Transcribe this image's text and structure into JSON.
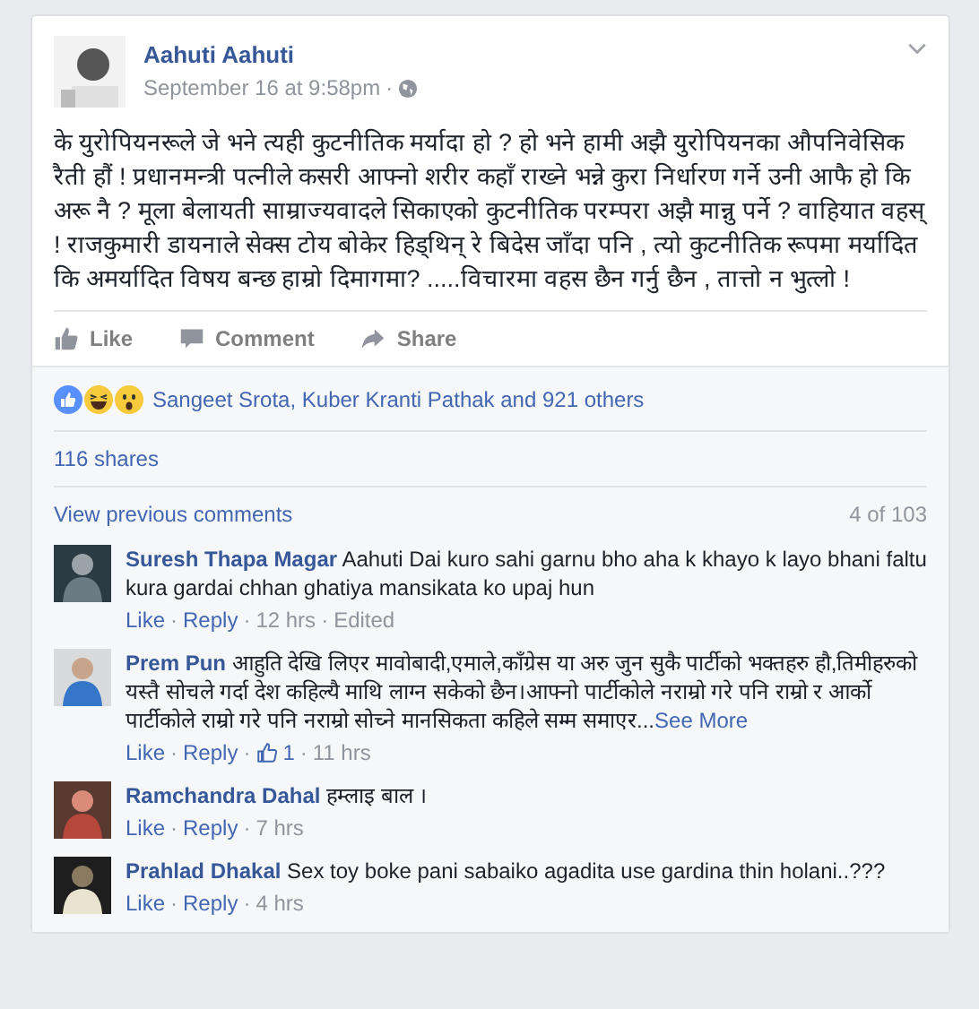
{
  "post": {
    "author": "Aahuti Aahuti",
    "timestamp": "September 16 at 9:58pm",
    "separator": "·",
    "text": "के युरोपियनरूले जे भने त्यही कुटनीतिक मर्यादा हो ? हो भने हामी अझै युरोपियनका औपनिवेसिक रैती हौं ! प्रधानमन्त्री पत्नीले कसरी आफ्नो शरीर कहाँ राख्ने भन्ने कुरा निर्धारण गर्ने उनी आफै हो कि अरू नै ? मूला बेलायती साम्राज्यवादले सिकाएको कुटनीतिक परम्परा अझै मान्नु पर्ने ? वाहियात वहस् ! राजकुमारी डायनाले सेक्स टोय बोकेर हिड्थिन् रे बिदेस जाँदा पनि , त्यो कुटनीतिक रूपमा मर्यादित कि अमर्यादित विषय बन्छ हाम्रो दिमागमा? .....विचारमा वहस छैन गर्नु छैन , तात्तो न भुत्लो !"
  },
  "actions": [
    "Like",
    "Comment",
    "Share"
  ],
  "reactions": {
    "summary": "Sangeet Srota, Kuber Kranti Pathak and 921 others"
  },
  "shares": "116 shares",
  "comments_header": {
    "link": "View previous comments",
    "count": "4 of 103"
  },
  "comments": [
    {
      "author": "Suresh Thapa Magar",
      "text": "Aahuti Dai kuro sahi garnu bho aha k khayo k layo bhani faltu kura gardai chhan ghatiya mansikata ko upaj hun",
      "meta": [
        {
          "kind": "like",
          "text": "Like"
        },
        {
          "kind": "sep",
          "text": "·"
        },
        {
          "kind": "reply",
          "text": "Reply"
        },
        {
          "kind": "sep",
          "text": "·"
        },
        {
          "kind": "time",
          "text": "12 hrs"
        },
        {
          "kind": "sep",
          "text": "·"
        },
        {
          "kind": "edited",
          "text": "Edited"
        }
      ]
    },
    {
      "author": "Prem Pun",
      "text": "आहुति देखि लिएर मावोबादी,एमाले,काँग्रेस या अरु जुन सुकै पार्टीको भक्तहरु हौ,तिमीहरुको यस्तै सोचले गर्दा देश कहिल्यै माथि लाग्न सकेको छैन।आफ्नो पार्टीकोले नराम्रो गरे पनि राम्रो र आर्को पार्टीकोले राम्रो गरे पनि नराम्रो सोच्ने मानसिकता कहिले सम्म समाएर...",
      "see_more": "See More",
      "meta": [
        {
          "kind": "like",
          "text": "Like"
        },
        {
          "kind": "sep",
          "text": "·"
        },
        {
          "kind": "reply",
          "text": "Reply"
        },
        {
          "kind": "sep",
          "text": "·"
        },
        {
          "kind": "likes",
          "text": "1"
        },
        {
          "kind": "sep",
          "text": "·"
        },
        {
          "kind": "time",
          "text": "11 hrs"
        }
      ]
    },
    {
      "author": "Ramchandra Dahal",
      "text": "हम्लाइ बाल ।",
      "meta": [
        {
          "kind": "like",
          "text": "Like"
        },
        {
          "kind": "sep",
          "text": "·"
        },
        {
          "kind": "reply",
          "text": "Reply"
        },
        {
          "kind": "sep",
          "text": "·"
        },
        {
          "kind": "time",
          "text": "7 hrs"
        }
      ]
    },
    {
      "author": "Prahlad Dhakal",
      "text": "Sex toy boke pani sabaiko agadita use gardina thin holani..???",
      "meta": [
        {
          "kind": "like",
          "text": "Like"
        },
        {
          "kind": "sep",
          "text": "·"
        },
        {
          "kind": "reply",
          "text": "Reply"
        },
        {
          "kind": "sep",
          "text": "·"
        },
        {
          "kind": "time",
          "text": "4 hrs"
        }
      ]
    }
  ]
}
